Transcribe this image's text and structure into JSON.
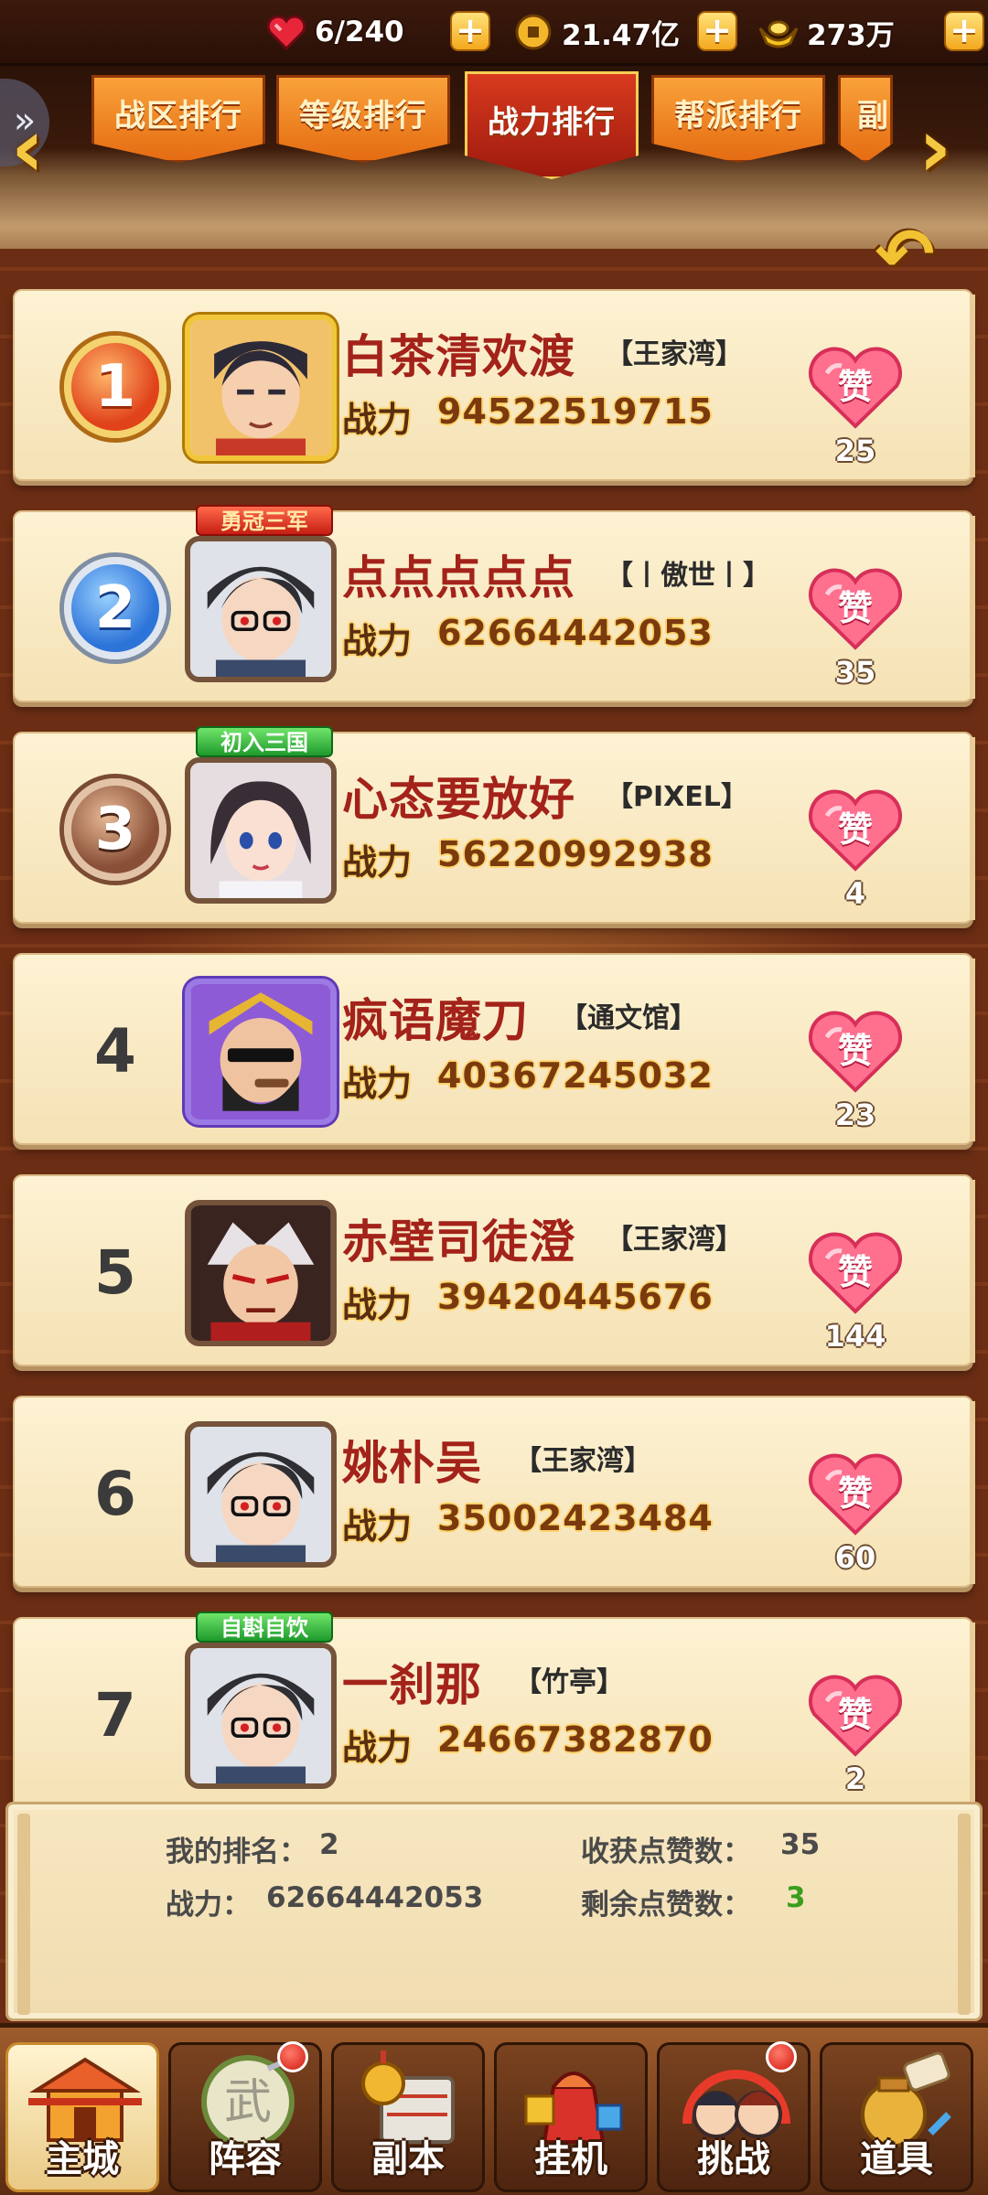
{
  "resources": {
    "stamina": {
      "icon": "heart-stamina-icon",
      "value": "6/240"
    },
    "coins": {
      "icon": "copper-coin-icon",
      "value": "21.47亿"
    },
    "ingots": {
      "icon": "gold-ingot-icon",
      "value": "273万"
    }
  },
  "tabs": [
    {
      "label": "战区排行",
      "active": false
    },
    {
      "label": "等级排行",
      "active": false
    },
    {
      "label": "战力排行",
      "active": true
    },
    {
      "label": "帮派排行",
      "active": false
    },
    {
      "label": "副",
      "active": false
    }
  ],
  "power_label": "战力",
  "like_label": "赞",
  "rankings": [
    {
      "rank": "1",
      "medal": "gold",
      "name": "白茶清欢渡",
      "guild": "【王家湾】",
      "power": "94522519715",
      "likes": "25",
      "frame": "gold",
      "title_tag": ""
    },
    {
      "rank": "2",
      "medal": "silver",
      "name": "点点点点点",
      "guild": "【丨傲世丨】",
      "power": "62664442053",
      "likes": "35",
      "frame": "normal",
      "title_tag": "勇冠三军"
    },
    {
      "rank": "3",
      "medal": "bronze",
      "name": "心态要放好",
      "guild": "【PIXEL】",
      "power": "56220992938",
      "likes": "4",
      "frame": "normal",
      "title_tag": "初入三国"
    },
    {
      "rank": "4",
      "medal": "",
      "name": "疯语魔刀",
      "guild": "【通文馆】",
      "power": "40367245032",
      "likes": "23",
      "frame": "purple",
      "title_tag": ""
    },
    {
      "rank": "5",
      "medal": "",
      "name": "赤壁司徒澄",
      "guild": "【王家湾】",
      "power": "39420445676",
      "likes": "144",
      "frame": "normal",
      "title_tag": ""
    },
    {
      "rank": "6",
      "medal": "",
      "name": "姚朴吴",
      "guild": "【王家湾】",
      "power": "35002423484",
      "likes": "60",
      "frame": "normal",
      "title_tag": ""
    },
    {
      "rank": "7",
      "medal": "",
      "name": "一刹那",
      "guild": "【竹亭】",
      "power": "24667382870",
      "likes": "2",
      "frame": "normal",
      "title_tag": "自斟自饮"
    }
  ],
  "my_rank": {
    "rank_label": "我的排名：",
    "rank_value": "2",
    "power_label": "战力：",
    "power_value": "62664442053",
    "received_label": "收获点赞数：",
    "received_value": "35",
    "remaining_label": "剩余点赞数：",
    "remaining_value": "3"
  },
  "nav": [
    {
      "label": "主城",
      "icon": "main-city-icon",
      "active": true,
      "dot": false
    },
    {
      "label": "阵容",
      "icon": "lineup-icon",
      "active": false,
      "dot": true
    },
    {
      "label": "副本",
      "icon": "dungeon-icon",
      "active": false,
      "dot": false
    },
    {
      "label": "挂机",
      "icon": "idle-icon",
      "active": false,
      "dot": false
    },
    {
      "label": "挑战",
      "icon": "challenge-icon",
      "active": false,
      "dot": true
    },
    {
      "label": "道具",
      "icon": "items-icon",
      "active": false,
      "dot": false
    }
  ]
}
